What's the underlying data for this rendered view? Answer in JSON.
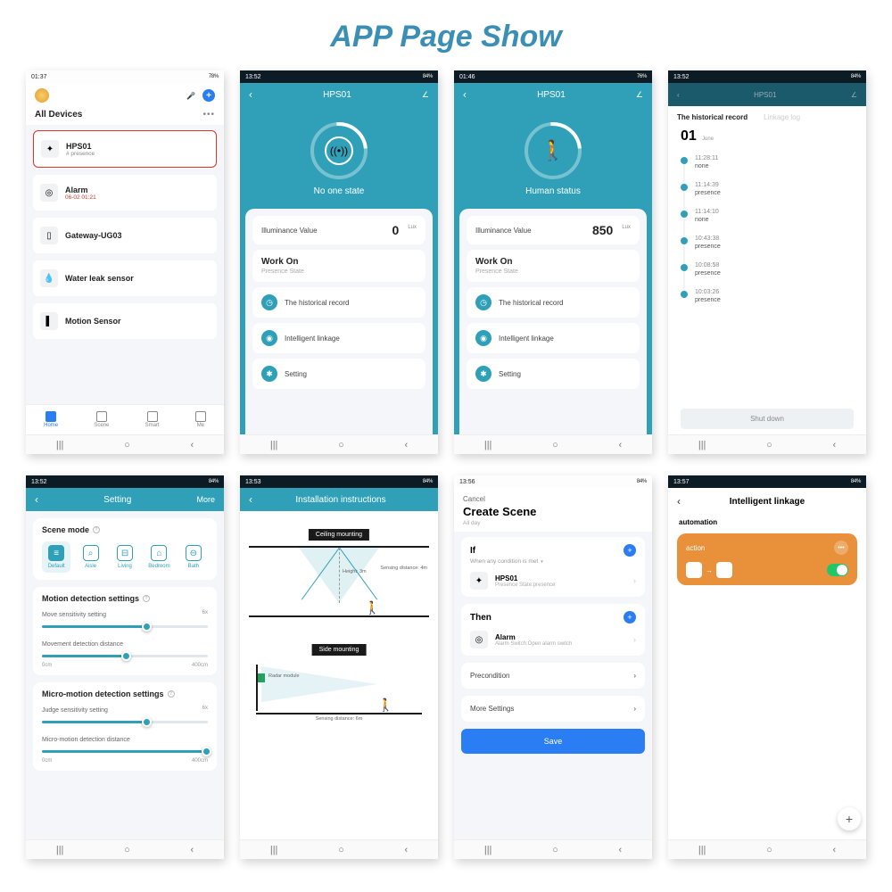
{
  "page_title": "APP Page Show",
  "screens": {
    "s1": {
      "status_time": "01:37",
      "status_right": "78%",
      "section_title": "All Devices",
      "devices": [
        {
          "name": "HPS01",
          "sub": "# presence",
          "highlight": true
        },
        {
          "name": "Alarm",
          "sub": "06-02 01:21",
          "red": true
        },
        {
          "name": "Gateway-UG03",
          "sub": ""
        },
        {
          "name": "Water leak sensor",
          "sub": ""
        },
        {
          "name": "Motion Sensor",
          "sub": ""
        }
      ],
      "nav": [
        "Home",
        "Scene",
        "Smart",
        "Me"
      ]
    },
    "s2": {
      "status_time": "13:52",
      "status_right": "84%",
      "title": "HPS01",
      "state_label": "No one state",
      "illum_label": "Illuminance Value",
      "illum_value": "0",
      "illum_unit": "Lux",
      "workon": "Work On",
      "workon_sub": "Presence State",
      "links": [
        "The historical record",
        "Intelligent linkage",
        "Setting"
      ]
    },
    "s3": {
      "status_time": "01:46",
      "status_right": "76%",
      "title": "HPS01",
      "state_label": "Human status",
      "illum_label": "Illuminance Value",
      "illum_value": "850",
      "illum_unit": "Lux",
      "workon": "Work On",
      "workon_sub": "Presence State",
      "links": [
        "The historical record",
        "Intelligent linkage",
        "Setting"
      ]
    },
    "s4": {
      "status_time": "13:52",
      "status_right": "84%",
      "title": "HPS01",
      "tab_active": "The historical record",
      "tab_other": "Linkage log",
      "day": "01",
      "month": "June",
      "rows": [
        {
          "t": "11:28:11",
          "s": "none"
        },
        {
          "t": "11:14:39",
          "s": "presence"
        },
        {
          "t": "11:14:10",
          "s": "none"
        },
        {
          "t": "10:43:38",
          "s": "presence"
        },
        {
          "t": "10:08:58",
          "s": "presence"
        },
        {
          "t": "10:03:26",
          "s": "presence"
        }
      ],
      "shut": "Shut down"
    },
    "s5": {
      "status_time": "13:52",
      "status_right": "84%",
      "title": "Setting",
      "more": "More",
      "scene_title": "Scene mode",
      "scenes": [
        "Default",
        "Aisle",
        "Living",
        "Bedroom",
        "Bath"
      ],
      "motion_title": "Motion detection settings",
      "move_sens": "Move sensitivity setting",
      "move_sens_max": "6x",
      "move_dist": "Movement detection distance",
      "dist_min": "0cm",
      "dist_max": "400cm",
      "micro_title": "Micro-motion detection settings",
      "judge_sens": "Judge sensitivity setting",
      "judge_max": "6x",
      "micro_dist": "Micro-motion detection distance"
    },
    "s6": {
      "status_time": "13:53",
      "status_right": "84%",
      "title": "Installation instructions",
      "ceiling": "Ceiling mounting",
      "side": "Side mounting",
      "height": "Height: 3m",
      "sense1": "Sensing distance: 4m",
      "radar": "Radar module",
      "sense2": "Sensing distance: 6m"
    },
    "s7": {
      "status_time": "13:56",
      "status_right": "84%",
      "cancel": "Cancel",
      "title": "Create Scene",
      "sub": "All day",
      "if": "If",
      "if_sub": "When any condition is met",
      "if_dev": "HPS01",
      "if_dev_sub": "Presence State:presence",
      "then": "Then",
      "then_dev": "Alarm",
      "then_dev_sub": "Alarm Switch:Open alarm switch",
      "precond": "Precondition",
      "more": "More Settings",
      "save": "Save"
    },
    "s8": {
      "status_time": "13:57",
      "status_right": "84%",
      "title": "Intelligent linkage",
      "sub": "automation",
      "action": "action"
    }
  }
}
